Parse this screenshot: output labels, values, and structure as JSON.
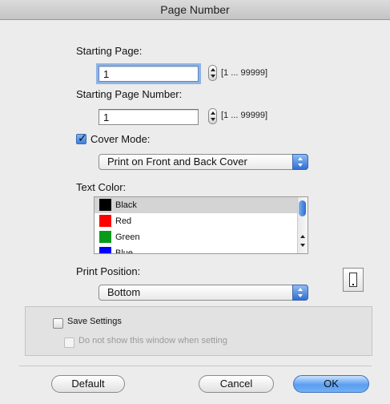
{
  "window": {
    "title": "Page Number"
  },
  "starting_page": {
    "label": "Starting Page:",
    "value": "1",
    "range": "[1 ... 99999]"
  },
  "starting_page_number": {
    "label": "Starting Page Number:",
    "value": "1",
    "range": "[1 ... 99999]"
  },
  "cover_mode": {
    "label": "Cover Mode:",
    "checked": true,
    "selected": "Print on Front and Back Cover"
  },
  "text_color": {
    "label": "Text Color:",
    "items": [
      {
        "name": "Black",
        "color": "#000000",
        "selected": true
      },
      {
        "name": "Red",
        "color": "#ff0000",
        "selected": false
      },
      {
        "name": "Green",
        "color": "#0a9a1a",
        "selected": false
      },
      {
        "name": "Blue",
        "color": "#0000ff",
        "selected": false
      }
    ]
  },
  "print_position": {
    "label": "Print Position:",
    "selected": "Bottom",
    "icon": "page-position-icon"
  },
  "save_settings": {
    "label": "Save Settings",
    "checked": false,
    "sub_label": "Do not show this window when setting",
    "sub_checked": false
  },
  "buttons": {
    "default": "Default",
    "cancel": "Cancel",
    "ok": "OK"
  },
  "colors": {
    "accent": "#3d80df",
    "selected_row": "#d4d4d4"
  }
}
